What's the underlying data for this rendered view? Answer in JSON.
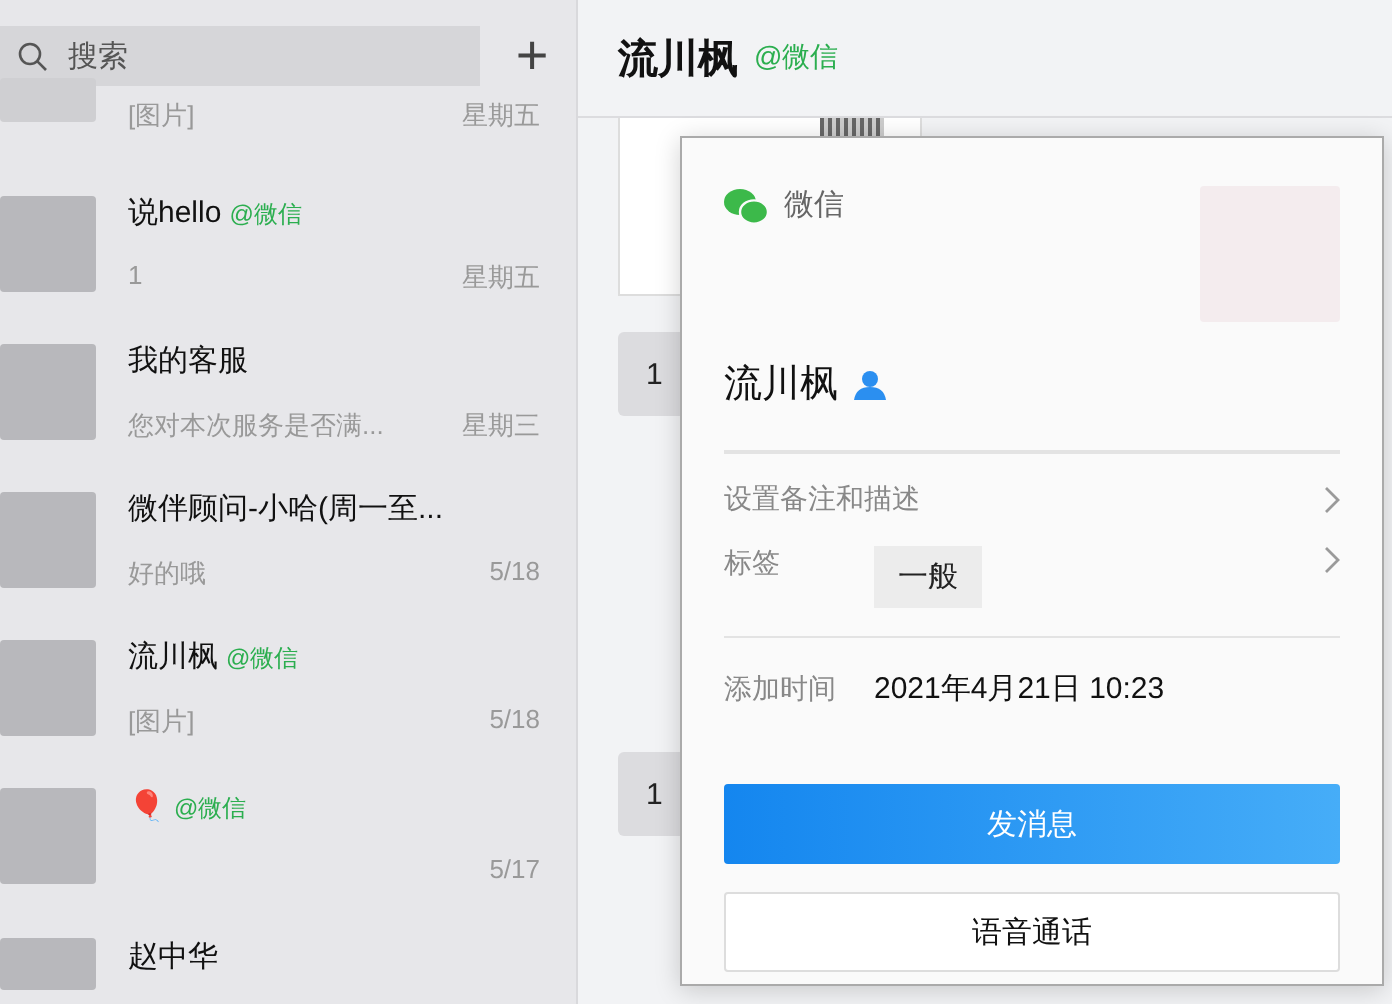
{
  "search": {
    "placeholder": "搜索"
  },
  "add_button": "+",
  "chats": [
    {
      "preview": "[图片]",
      "time": "星期五"
    },
    {
      "name": "说hello",
      "tag": "@微信",
      "preview": "1",
      "time": "星期五"
    },
    {
      "name": "我的客服",
      "preview": "您对本次服务是否满...",
      "time": "星期三"
    },
    {
      "name": "微伴顾问-小哈(周一至...",
      "preview": "好的哦",
      "time": "5/18"
    },
    {
      "name": "流川枫",
      "tag": "@微信",
      "preview": "[图片]",
      "time": "5/18"
    },
    {
      "name": "🎈",
      "tag": "@微信",
      "time": "5/17"
    },
    {
      "name": "赵中华"
    }
  ],
  "chat": {
    "title": "流川枫",
    "tag": "@微信",
    "messages": [
      {
        "kind": "card"
      },
      {
        "kind": "text",
        "text": "1"
      },
      {
        "kind": "text",
        "text": "1"
      }
    ]
  },
  "profile": {
    "source": "微信",
    "name": "流川枫",
    "rows": [
      {
        "kind": "link",
        "label": "设置备注和描述"
      },
      {
        "kind": "tag",
        "label": "标签",
        "value": "一般"
      },
      {
        "kind": "info",
        "label": "添加时间",
        "value": "2021年4月21日 10:23"
      }
    ],
    "buttons": [
      {
        "kind": "primary",
        "label": "发消息"
      },
      {
        "kind": "secondary",
        "label": "语音通话"
      }
    ]
  }
}
